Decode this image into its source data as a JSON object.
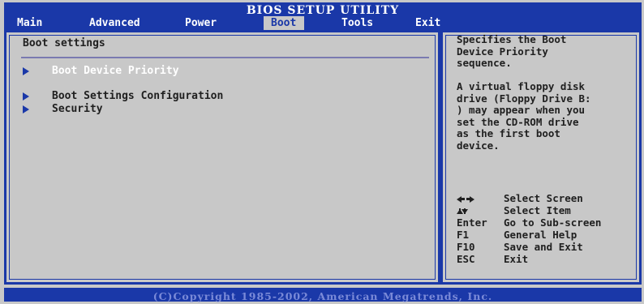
{
  "header": {
    "title": "BIOS SETUP UTILITY",
    "menu": [
      {
        "label": "Main",
        "active": false
      },
      {
        "label": "Advanced",
        "active": false
      },
      {
        "label": "Power",
        "active": false
      },
      {
        "label": "Boot",
        "active": true
      },
      {
        "label": "Tools",
        "active": false
      },
      {
        "label": "Exit",
        "active": false
      }
    ]
  },
  "main": {
    "section_title": "Boot settings",
    "items": [
      {
        "label": "Boot Device Priority",
        "selected": true
      },
      {
        "label": "Boot Settings Configuration",
        "selected": false
      },
      {
        "label": "Security",
        "selected": false
      }
    ]
  },
  "help": {
    "description": "Specifies the Boot\nDevice Priority\nsequence.\n\nA virtual floppy disk\ndrive (Floppy Drive B:\n) may appear when you\nset the CD-ROM drive\nas the first boot\ndevice.",
    "keys": [
      {
        "key_icon": "left-right-arrows-icon",
        "key": "",
        "desc": "Select Screen"
      },
      {
        "key_icon": "up-down-arrows-icon",
        "key": "",
        "desc": "Select Item"
      },
      {
        "key": "Enter",
        "desc": "Go to Sub-screen"
      },
      {
        "key": "F1",
        "desc": "General Help"
      },
      {
        "key": "F10",
        "desc": "Save and Exit"
      },
      {
        "key": "ESC",
        "desc": "Exit"
      }
    ]
  },
  "footer": {
    "copyright": "(C)Copyright 1985-2002, American Megatrends, Inc."
  },
  "colors": {
    "bar_blue": "#1a38a8",
    "panel_gray": "#c8c8c8",
    "text_dark": "#202020",
    "selected_text": "#ffffff"
  }
}
